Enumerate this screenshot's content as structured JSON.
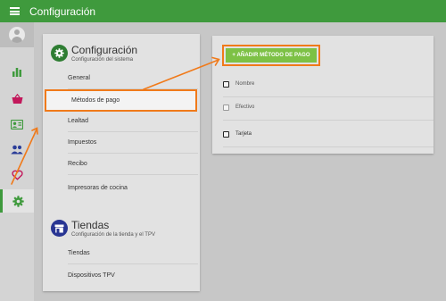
{
  "topbar": {
    "title": "Configuración"
  },
  "rail": {
    "items": [
      {
        "icon": "bar-chart-icon"
      },
      {
        "icon": "basket-icon"
      },
      {
        "icon": "contact-card-icon"
      },
      {
        "icon": "people-icon"
      },
      {
        "icon": "heart-icon"
      },
      {
        "icon": "gear-icon"
      }
    ]
  },
  "config_section": {
    "title": "Configuración",
    "subtitle": "Configuración del sistema",
    "items": [
      "General",
      "Métodos de pago",
      "Lealtad",
      "Impuestos",
      "Recibo",
      "Impresoras de cocina"
    ]
  },
  "tiendas_section": {
    "title": "Tiendas",
    "subtitle": "Configuración de la tienda y el TPV",
    "items": [
      "Tiendas",
      "Dispositivos TPV"
    ]
  },
  "payment_methods": {
    "add_button": "+ AÑADIR MÉTODO DE PAGO",
    "header": "Nombre",
    "rows": [
      "Efectivo",
      "Tarjeta"
    ]
  },
  "colors": {
    "accent_green": "#3f9a3d",
    "button_green": "#7dc145",
    "annotation_orange": "#f07a1a"
  }
}
